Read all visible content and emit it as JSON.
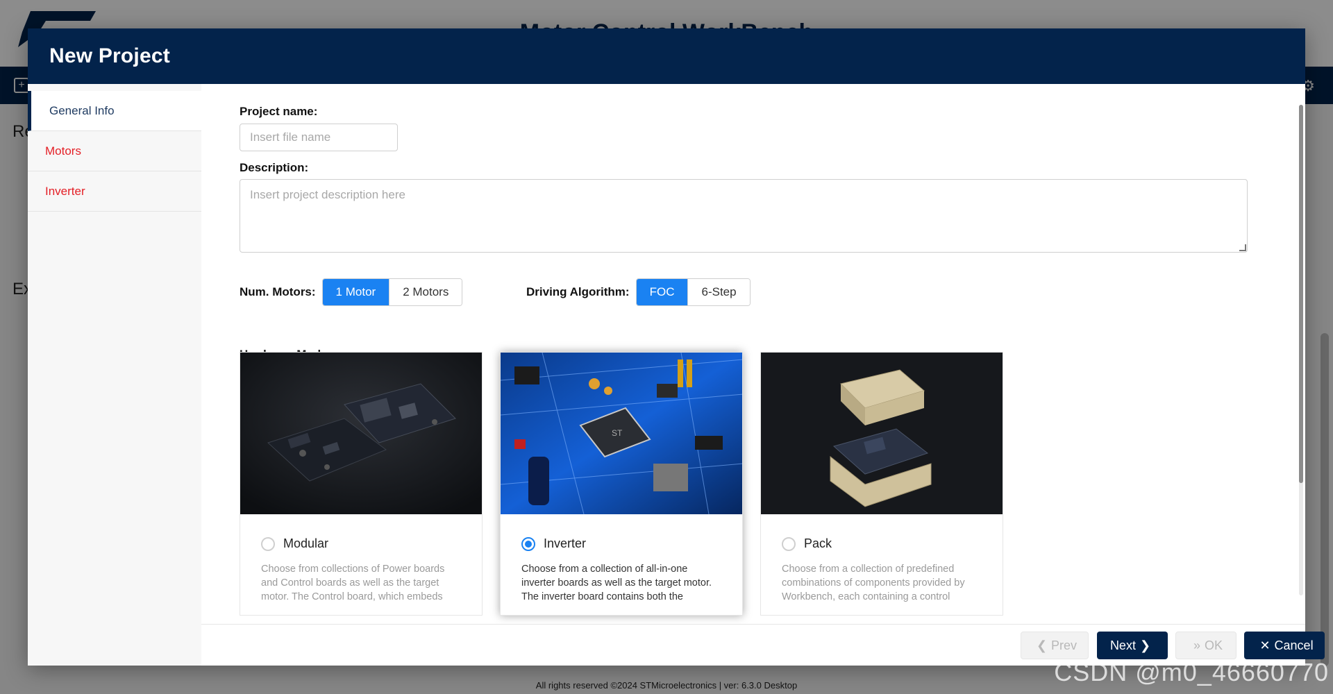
{
  "background": {
    "app_title": "Motor Control WorkBench",
    "heading_1": "Re",
    "heading_2": "Ex",
    "footer": "All rights reserved ©2024 STMicroelectronics | ver: 6.3.0 Desktop"
  },
  "modal": {
    "title": "New Project",
    "sidebar": {
      "items": [
        {
          "label": "General Info",
          "active": true
        },
        {
          "label": "Motors",
          "active": false
        },
        {
          "label": "Inverter",
          "active": false
        }
      ]
    },
    "form": {
      "project_name_label": "Project name:",
      "project_name_placeholder": "Insert file name",
      "description_label": "Description:",
      "description_placeholder": "Insert project description here",
      "num_motors_label": "Num. Motors:",
      "num_motors_options": [
        "1 Motor",
        "2 Motors"
      ],
      "num_motors_selected": "1 Motor",
      "driving_algorithm_label": "Driving Algorithm:",
      "driving_algorithm_options": [
        "FOC",
        "6-Step"
      ],
      "driving_algorithm_selected": "FOC",
      "hardware_mode_label": "Hardware Mode:",
      "hardware_modes": [
        {
          "name": "Modular",
          "selected": false,
          "description": "Choose from collections of Power boards and Control boards as well as the target motor. The Control board, which embeds"
        },
        {
          "name": "Inverter",
          "selected": true,
          "description": "Choose from a collection of all-in-one inverter boards as well as the target motor. The inverter board contains both the"
        },
        {
          "name": "Pack",
          "selected": false,
          "description": "Choose from a collection of predefined combinations of components provided by Workbench, each containing a control"
        }
      ]
    },
    "footer_buttons": {
      "prev_label": "Prev",
      "next_label": "Next",
      "ok_label": "OK",
      "cancel_label": "Cancel"
    }
  },
  "watermark": "CSDN @m0_46660770",
  "colors": {
    "brand_navy": "#03234b",
    "accent_blue": "#1a82f2",
    "sidebar_link_red": "#e41f26"
  }
}
